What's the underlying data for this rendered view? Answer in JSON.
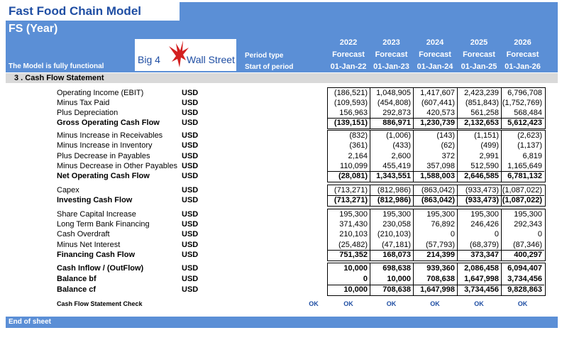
{
  "header": {
    "title": "Fast Food Chain Model",
    "subtitle": "FS (Year)",
    "status": "The Model is fully functional",
    "logo_left": "Big 4",
    "logo_right": "Wall Street",
    "period_type_label": "Period type",
    "start_period_label": "Start of period",
    "years": [
      {
        "year": "2022",
        "type": "Forecast",
        "start": "01-Jan-22"
      },
      {
        "year": "2023",
        "type": "Forecast",
        "start": "01-Jan-23"
      },
      {
        "year": "2024",
        "type": "Forecast",
        "start": "01-Jan-24"
      },
      {
        "year": "2025",
        "type": "Forecast",
        "start": "01-Jan-25"
      },
      {
        "year": "2026",
        "type": "Forecast",
        "start": "01-Jan-26"
      }
    ]
  },
  "section_title": "3 .  Cash Flow Statement",
  "rows": [
    {
      "label": "Operating Income (EBIT)",
      "unit": "USD",
      "bold": false,
      "values": [
        "(186,521)",
        "1,048,905",
        "1,417,607",
        "2,423,239",
        "6,796,708"
      ]
    },
    {
      "label": "Minus Tax Paid",
      "unit": "USD",
      "bold": false,
      "values": [
        "(109,593)",
        "(454,808)",
        "(607,441)",
        "(851,843)",
        "(1,752,769)"
      ]
    },
    {
      "label": "Plus Depreciation",
      "unit": "USD",
      "bold": false,
      "values": [
        "156,963",
        "292,873",
        "420,573",
        "561,258",
        "568,484"
      ]
    },
    {
      "label": "Gross Operating Cash Flow",
      "unit": "USD",
      "bold": true,
      "values": [
        "(139,151)",
        "886,971",
        "1,230,739",
        "2,132,653",
        "5,612,423"
      ]
    },
    {
      "label": "Minus Increase in Receivables",
      "unit": "USD",
      "bold": false,
      "values": [
        "(832)",
        "(1,006)",
        "(143)",
        "(1,151)",
        "(2,623)"
      ]
    },
    {
      "label": "Minus Increase in Inventory",
      "unit": "USD",
      "bold": false,
      "values": [
        "(361)",
        "(433)",
        "(62)",
        "(499)",
        "(1,137)"
      ]
    },
    {
      "label": "Plus Decrease in Payables",
      "unit": "USD",
      "bold": false,
      "values": [
        "2,164",
        "2,600",
        "372",
        "2,991",
        "6,819"
      ]
    },
    {
      "label": "Minus Decrease in Other Payables",
      "unit": "USD",
      "bold": false,
      "values": [
        "110,099",
        "455,419",
        "357,098",
        "512,590",
        "1,165,649"
      ]
    },
    {
      "label": "Net Operating Cash Flow",
      "unit": "USD",
      "bold": true,
      "values": [
        "(28,081)",
        "1,343,551",
        "1,588,003",
        "2,646,585",
        "6,781,132"
      ]
    },
    {
      "label": "Capex",
      "unit": "USD",
      "bold": false,
      "values": [
        "(713,271)",
        "(812,986)",
        "(863,042)",
        "(933,473)",
        "(1,087,022)"
      ]
    },
    {
      "label": "Investing Cash Flow",
      "unit": "USD",
      "bold": true,
      "values": [
        "(713,271)",
        "(812,986)",
        "(863,042)",
        "(933,473)",
        "(1,087,022)"
      ]
    },
    {
      "label": "Share Capital Increase",
      "unit": "USD",
      "bold": false,
      "values": [
        "195,300",
        "195,300",
        "195,300",
        "195,300",
        "195,300"
      ]
    },
    {
      "label": "Long Term Bank Financing",
      "unit": "USD",
      "bold": false,
      "values": [
        "371,430",
        "230,058",
        "76,892",
        "246,426",
        "292,343"
      ]
    },
    {
      "label": "Cash Overdraft",
      "unit": "USD",
      "bold": false,
      "values": [
        "210,103",
        "(210,103)",
        "0",
        "0",
        "0"
      ]
    },
    {
      "label": "Minus Net Interest",
      "unit": "USD",
      "bold": false,
      "values": [
        "(25,482)",
        "(47,181)",
        "(57,793)",
        "(68,379)",
        "(87,346)"
      ]
    },
    {
      "label": "Financing Cash Flow",
      "unit": "USD",
      "bold": true,
      "values": [
        "751,352",
        "168,073",
        "214,399",
        "373,347",
        "400,297"
      ]
    },
    {
      "label": "Cash Inflow / (OutFlow)",
      "unit": "USD",
      "bold": true,
      "values": [
        "10,000",
        "698,638",
        "939,360",
        "2,086,458",
        "6,094,407"
      ]
    },
    {
      "label": "Balance bf",
      "unit": "USD",
      "bold": true,
      "values": [
        "0",
        "10,000",
        "708,638",
        "1,647,998",
        "3,734,456"
      ]
    },
    {
      "label": "Balance cf",
      "unit": "USD",
      "bold": true,
      "values": [
        "10,000",
        "708,638",
        "1,647,998",
        "3,734,456",
        "9,828,863"
      ]
    }
  ],
  "check": {
    "label": "Cash Flow Statement Check",
    "overall": "OK",
    "values": [
      "OK",
      "OK",
      "OK",
      "OK",
      "OK"
    ]
  },
  "footer": "End of sheet",
  "colors": {
    "band": "#5b8fd6",
    "title": "#1f4ea3",
    "ok": "#1f4ea3",
    "section": "#d9d9d9"
  }
}
